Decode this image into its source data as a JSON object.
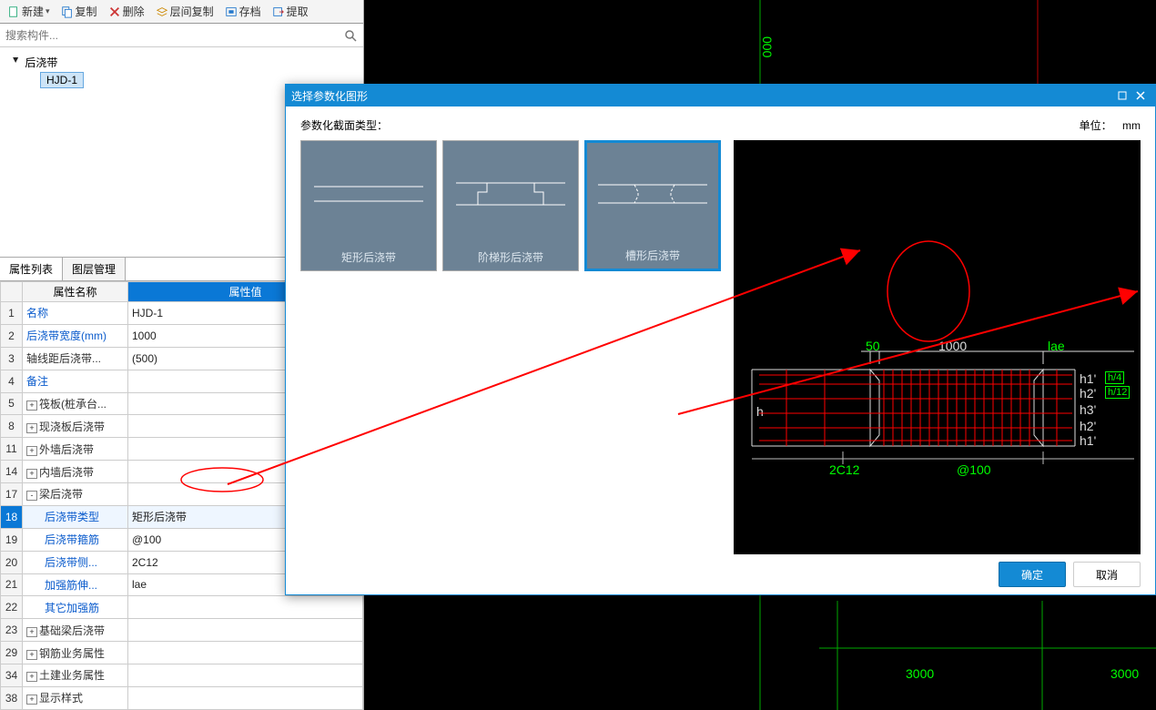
{
  "toolbar": {
    "new": "新建",
    "copy": "复制",
    "delete": "删除",
    "layer_copy": "层间复制",
    "archive": "存档",
    "extract": "提取"
  },
  "search": {
    "placeholder": "搜索构件..."
  },
  "tree": {
    "root": "后浇带",
    "child": "HJD-1"
  },
  "tabs": {
    "props": "属性列表",
    "layers": "图层管理"
  },
  "prop_headers": {
    "name": "属性名称",
    "value": "属性值"
  },
  "props": [
    {
      "n": "1",
      "name": "名称",
      "value": "HJD-1",
      "cls": ""
    },
    {
      "n": "2",
      "name": "后浇带宽度(mm)",
      "value": "1000",
      "cls": ""
    },
    {
      "n": "3",
      "name": "轴线距后浇带...",
      "value": "(500)",
      "cls": "black"
    },
    {
      "n": "4",
      "name": "备注",
      "value": "",
      "cls": ""
    },
    {
      "n": "5",
      "name": "筏板(桩承台...",
      "value": "",
      "cls": "black",
      "exp": "+"
    },
    {
      "n": "8",
      "name": "现浇板后浇带",
      "value": "",
      "cls": "black",
      "exp": "+"
    },
    {
      "n": "11",
      "name": "外墙后浇带",
      "value": "",
      "cls": "black",
      "exp": "+"
    },
    {
      "n": "14",
      "name": "内墙后浇带",
      "value": "",
      "cls": "black",
      "exp": "+"
    },
    {
      "n": "17",
      "name": "梁后浇带",
      "value": "",
      "cls": "black",
      "exp": "-"
    },
    {
      "n": "18",
      "name": "后浇带类型",
      "value": "矩形后浇带",
      "cls": "indent",
      "sel": true
    },
    {
      "n": "19",
      "name": "后浇带箍筋",
      "value": "@100",
      "cls": "indent"
    },
    {
      "n": "20",
      "name": "后浇带侧...",
      "value": "2C12",
      "cls": "indent"
    },
    {
      "n": "21",
      "name": "加强筋伸...",
      "value": "lae",
      "cls": "indent"
    },
    {
      "n": "22",
      "name": "其它加强筋",
      "value": "",
      "cls": "indent"
    },
    {
      "n": "23",
      "name": "基础梁后浇带",
      "value": "",
      "cls": "black",
      "exp": "+"
    },
    {
      "n": "29",
      "name": "钢筋业务属性",
      "value": "",
      "cls": "black",
      "exp": "+"
    },
    {
      "n": "34",
      "name": "土建业务属性",
      "value": "",
      "cls": "black",
      "exp": "+"
    },
    {
      "n": "38",
      "name": "显示样式",
      "value": "",
      "cls": "black",
      "exp": "+"
    }
  ],
  "dialog": {
    "title": "选择参数化图形",
    "section_label": "参数化截面类型：",
    "unit_label": "单位：",
    "unit_value": "mm",
    "templates": [
      "矩形后浇带",
      "阶梯形后浇带",
      "槽形后浇带"
    ],
    "selected_template": 2,
    "ok": "确定",
    "cancel": "取消"
  },
  "preview_labels": {
    "fifty": "50",
    "w": "1000",
    "lae": "lae",
    "h": "h",
    "h1p": "h1'",
    "h2p": "h2'",
    "h3p": "h3'",
    "h2p2": "h2'",
    "h1p2": "h1'",
    "h4": "h/4",
    "h12": "h/12",
    "rebar_left": "2C12",
    "rebar_right": "@100"
  },
  "cad_dims": {
    "vertical": "000",
    "d1": "3000",
    "d2": "3000"
  }
}
